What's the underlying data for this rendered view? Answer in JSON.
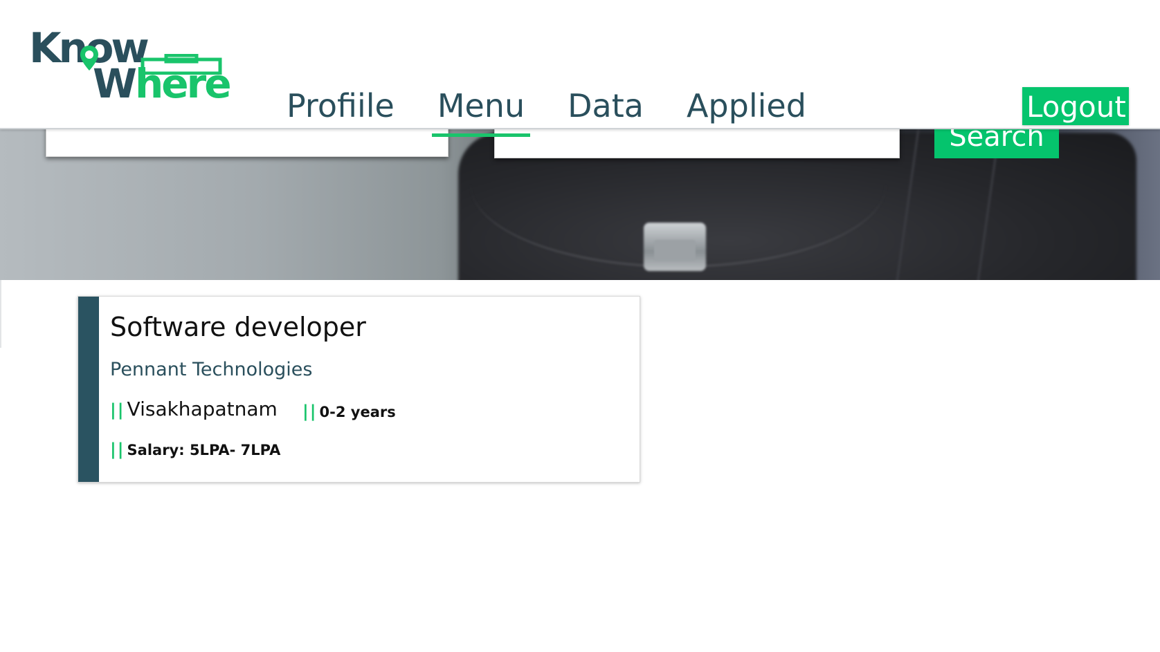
{
  "brand": {
    "logo_line1": "Know",
    "logo_line2_a": "W",
    "logo_line2_b": "here",
    "colors": {
      "dark": "#2a4f5c",
      "green": "#19c46b"
    }
  },
  "nav": {
    "items": [
      {
        "label": "Profiile",
        "active": false
      },
      {
        "label": "Menu",
        "active": true
      },
      {
        "label": "Data",
        "active": false
      },
      {
        "label": "Applied",
        "active": false
      }
    ],
    "logout_label": "Logout"
  },
  "search": {
    "keyword_value": "",
    "location_value": "",
    "button_label": "Search"
  },
  "job": {
    "title": "Software developer",
    "company": "Pennant Technologies",
    "bars": "||",
    "location": "Visakhapatnam",
    "experience": "0-2 years",
    "salary": "Salary: 5LPA- 7LPA"
  }
}
